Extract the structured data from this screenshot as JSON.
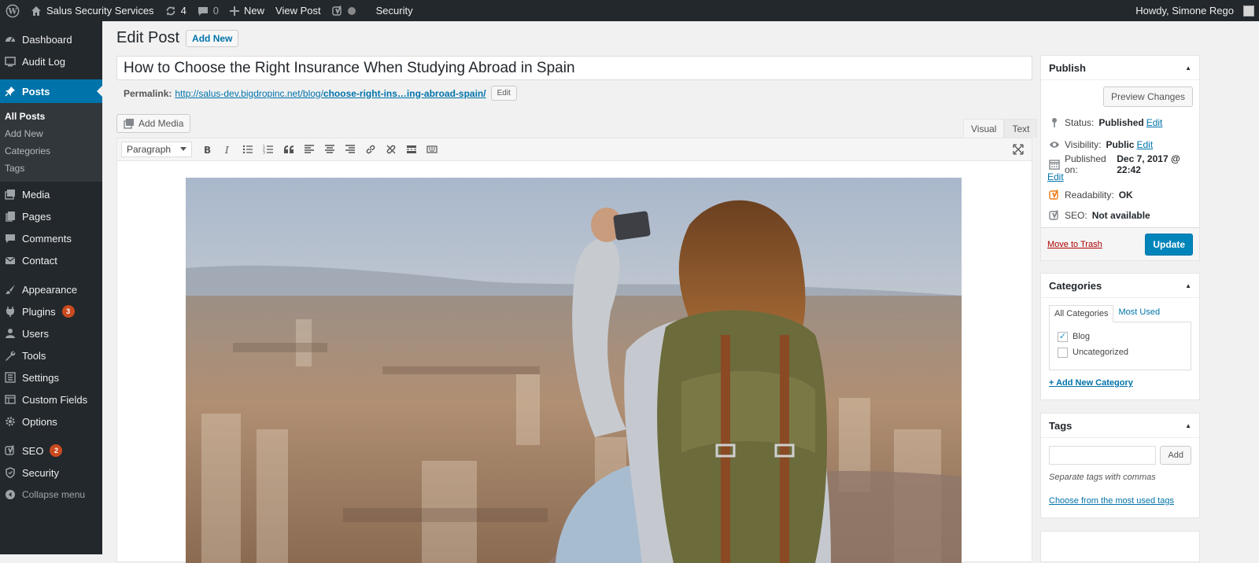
{
  "adminbar": {
    "site_name": "Salus Security Services",
    "updates_count": "4",
    "comments_count": "0",
    "new_label": "New",
    "view_post_label": "View Post",
    "security_label": "Security",
    "howdy": "Howdy, Simone Rego"
  },
  "sidebar": {
    "dashboard": "Dashboard",
    "audit_log": "Audit Log",
    "posts": "Posts",
    "posts_sub": [
      "All Posts",
      "Add New",
      "Categories",
      "Tags"
    ],
    "media": "Media",
    "pages": "Pages",
    "comments": "Comments",
    "contact": "Contact",
    "appearance": "Appearance",
    "plugins": "Plugins",
    "plugins_badge": "3",
    "users": "Users",
    "tools": "Tools",
    "settings": "Settings",
    "custom_fields": "Custom Fields",
    "options": "Options",
    "seo": "SEO",
    "seo_badge": "2",
    "security": "Security",
    "collapse": "Collapse menu"
  },
  "editor": {
    "page_title": "Edit Post",
    "add_new_label": "Add New",
    "post_title": "How to Choose the Right Insurance When Studying Abroad in Spain",
    "permalink_label": "Permalink:",
    "permalink_base": "http://salus-dev.bigdropinc.net/blog/",
    "permalink_slug": "choose-right-ins…ing-abroad-spain/",
    "permalink_edit": "Edit",
    "add_media_label": "Add Media",
    "tab_visual": "Visual",
    "tab_text": "Text",
    "format_select": "Paragraph"
  },
  "publish": {
    "title": "Publish",
    "preview_label": "Preview Changes",
    "status_label": "Status:",
    "status_value": "Published",
    "visibility_label": "Visibility:",
    "visibility_value": "Public",
    "published_label": "Published on:",
    "published_value": "Dec 7, 2017 @ 22:42",
    "edit_label": "Edit",
    "readability_label": "Readability:",
    "readability_value": "OK",
    "seo_label": "SEO:",
    "seo_value": "Not available",
    "trash_label": "Move to Trash",
    "update_label": "Update"
  },
  "categories": {
    "title": "Categories",
    "tab_all": "All Categories",
    "tab_most_used": "Most Used",
    "items": [
      {
        "label": "Blog",
        "checked": true
      },
      {
        "label": "Uncategorized",
        "checked": false
      }
    ],
    "add_new": "+ Add New Category"
  },
  "tags": {
    "title": "Tags",
    "input_value": "",
    "add_label": "Add",
    "hint": "Separate tags with commas",
    "choose": "Choose from the most used tags"
  },
  "colors": {
    "admin_dark": "#23282d",
    "accent": "#0073aa",
    "primary_button": "#0085ba",
    "badge": "#ca4a1f"
  },
  "icons": {
    "toolbar": [
      "bold-icon",
      "italic-icon",
      "bullet-list-icon",
      "numbered-list-icon",
      "blockquote-icon",
      "align-left-icon",
      "align-center-icon",
      "align-right-icon",
      "link-icon",
      "unlink-icon",
      "read-more-icon",
      "toolbar-toggle-icon"
    ]
  }
}
